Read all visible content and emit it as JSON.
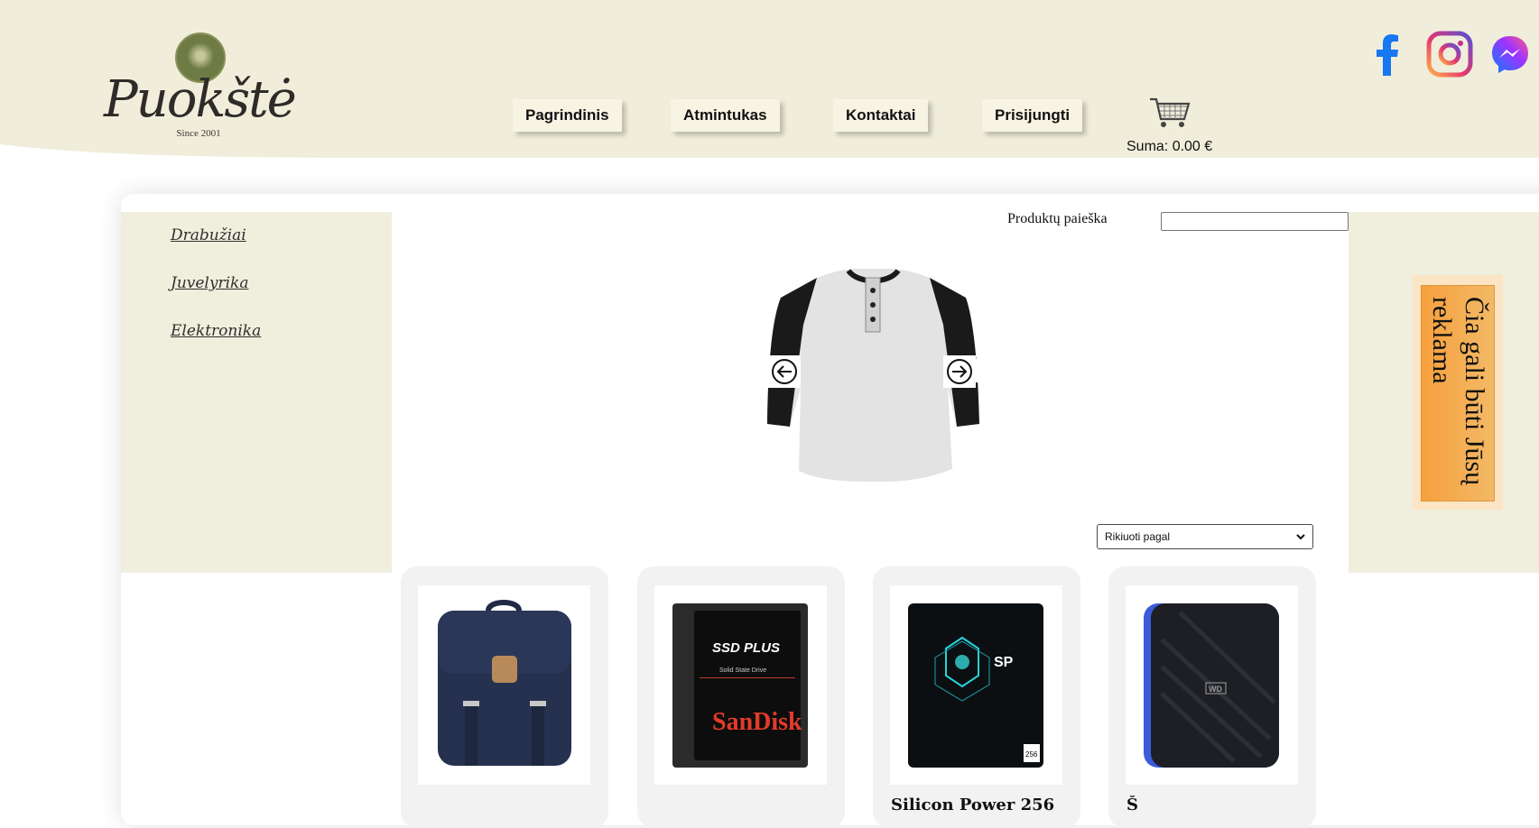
{
  "header": {
    "logo": {
      "name": "Puokštė",
      "since": "Since 2001"
    },
    "nav": [
      {
        "label": "Pagrindinis"
      },
      {
        "label": "Atmintukas"
      },
      {
        "label": "Kontaktai"
      },
      {
        "label": "Prisijungti"
      }
    ],
    "cart": {
      "sum_label": "Suma: 0.00 €",
      "icon": "cart-icon"
    },
    "social": [
      {
        "name": "facebook-icon"
      },
      {
        "name": "instagram-icon"
      },
      {
        "name": "messenger-icon"
      }
    ]
  },
  "sidebar": {
    "categories": [
      {
        "label": "Drabužiai"
      },
      {
        "label": "Juvelyrika"
      },
      {
        "label": "Elektronika"
      }
    ]
  },
  "search": {
    "label": "Produktų paieška",
    "placeholder": "",
    "value": ""
  },
  "slider": {
    "prev_icon": "arrow-left-icon",
    "next_icon": "arrow-right-icon",
    "image": "henley-shirt"
  },
  "sort": {
    "selected": "Rikiuoti pagal"
  },
  "ad": {
    "text": "Čia gali būti Jūsų reklama"
  },
  "products": [
    {
      "image": "backpack",
      "title": ""
    },
    {
      "image": "sandisk-ssd-plus",
      "title": ""
    },
    {
      "image": "silicon-power-ssd",
      "title": "Silicon Power 256"
    },
    {
      "image": "wd-external-drive",
      "title": "Š"
    }
  ],
  "colors": {
    "header_bg": "#f0eedb",
    "panel_bg": "#f0eedd",
    "card_bg": "#f2f2f2",
    "ad_bg": "#f6a03e"
  }
}
